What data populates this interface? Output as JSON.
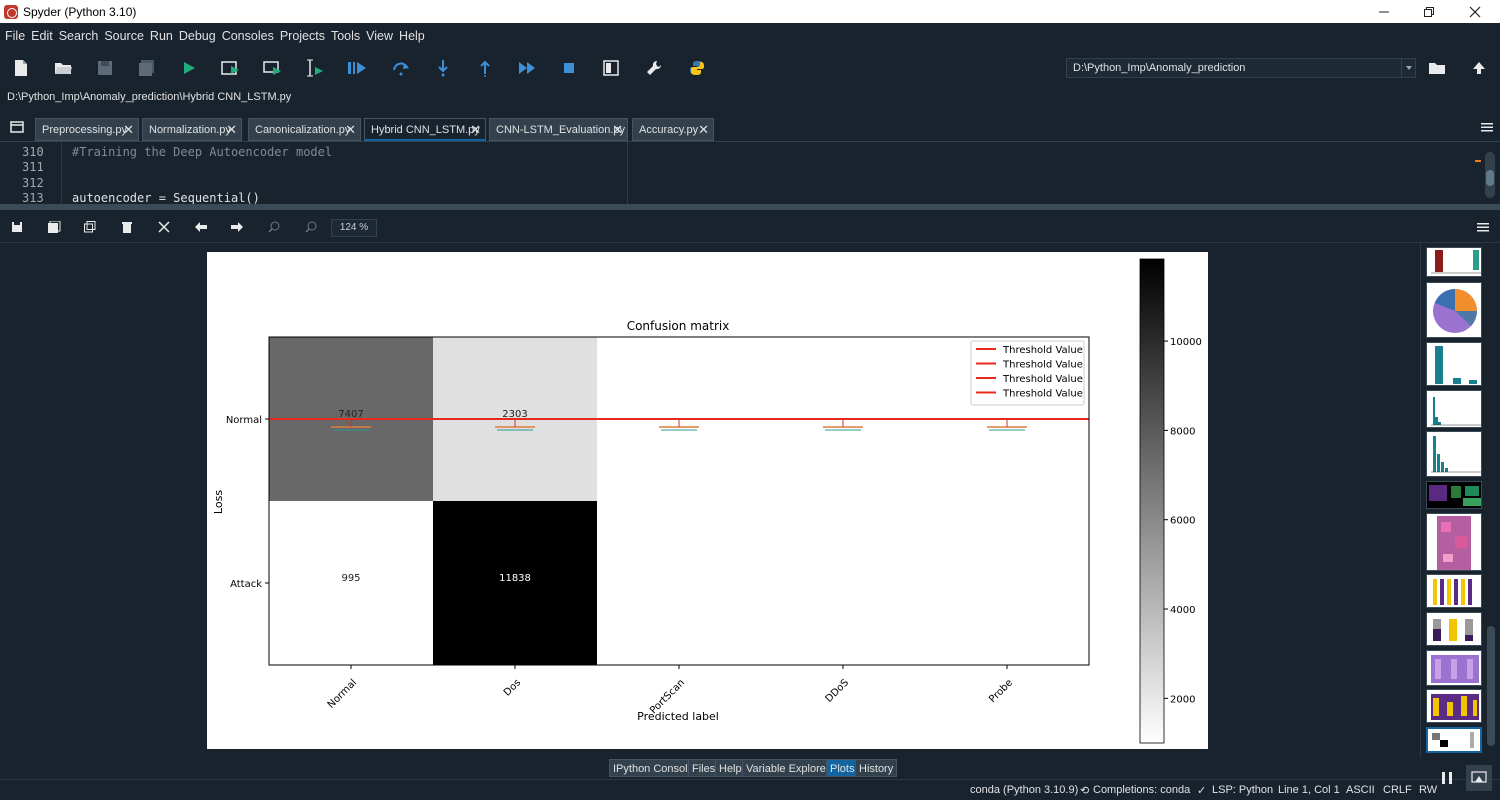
{
  "window": {
    "title": "Spyder (Python 3.10)"
  },
  "menu": [
    "File",
    "Edit",
    "Search",
    "Source",
    "Run",
    "Debug",
    "Consoles",
    "Projects",
    "Tools",
    "View",
    "Help"
  ],
  "toolbar": {
    "working_dir": "D:\\Python_Imp\\Anomaly_prediction"
  },
  "editor": {
    "file_path": "D:\\Python_Imp\\Anomaly_prediction\\Hybrid CNN_LSTM.py",
    "tabs": [
      "Preprocessing.py",
      "Normalization.py",
      "Canonicalization.py",
      "Hybrid CNN_LSTM.py",
      "CNN-LSTM_Evaluation.py",
      "Accuracy.py"
    ],
    "active_tab": "Hybrid CNN_LSTM.py",
    "lines": [
      {
        "no": "310",
        "text": "#Training the Deep Autoencoder model"
      },
      {
        "no": "311",
        "text": ""
      },
      {
        "no": "312",
        "text": ""
      },
      {
        "no": "313",
        "text": "autoencoder = Sequential()"
      }
    ]
  },
  "plots": {
    "zoom": "124 %"
  },
  "chart_data": {
    "type": "heatmap",
    "title": "Confusion matrix",
    "xlabel": "Predicted label",
    "ylabel": "Loss",
    "x_categories": [
      "Normal",
      "Dos",
      "PortScan",
      "DDoS",
      "Probe"
    ],
    "y_categories": [
      "Normal",
      "Attack"
    ],
    "cells": [
      {
        "row": "Normal",
        "col": "Normal",
        "value": 7407
      },
      {
        "row": "Normal",
        "col": "Dos",
        "value": 2303
      },
      {
        "row": "Attack",
        "col": "Normal",
        "value": 995
      },
      {
        "row": "Attack",
        "col": "Dos",
        "value": 11838
      }
    ],
    "colorbar_ticks": [
      "2000",
      "4000",
      "6000",
      "8000",
      "10000"
    ],
    "colorbar_range": [
      1000,
      11838
    ],
    "legend": [
      "Threshold Value",
      "Threshold Value",
      "Threshold Value",
      "Threshold Value"
    ],
    "legend_position": "top-right",
    "threshold_color": "#e8291c"
  },
  "bottom_tabs": [
    "IPython Console",
    "Files",
    "Help",
    "Variable Explorer",
    "Plots",
    "History"
  ],
  "active_bottom_tab": "Plots",
  "status": {
    "env": "conda (Python 3.10.9)",
    "completions": "Completions: conda",
    "lsp": "LSP: Python",
    "position": "Line 1, Col 1",
    "encoding": "ASCII",
    "eol": "CRLF",
    "perm": "RW"
  }
}
